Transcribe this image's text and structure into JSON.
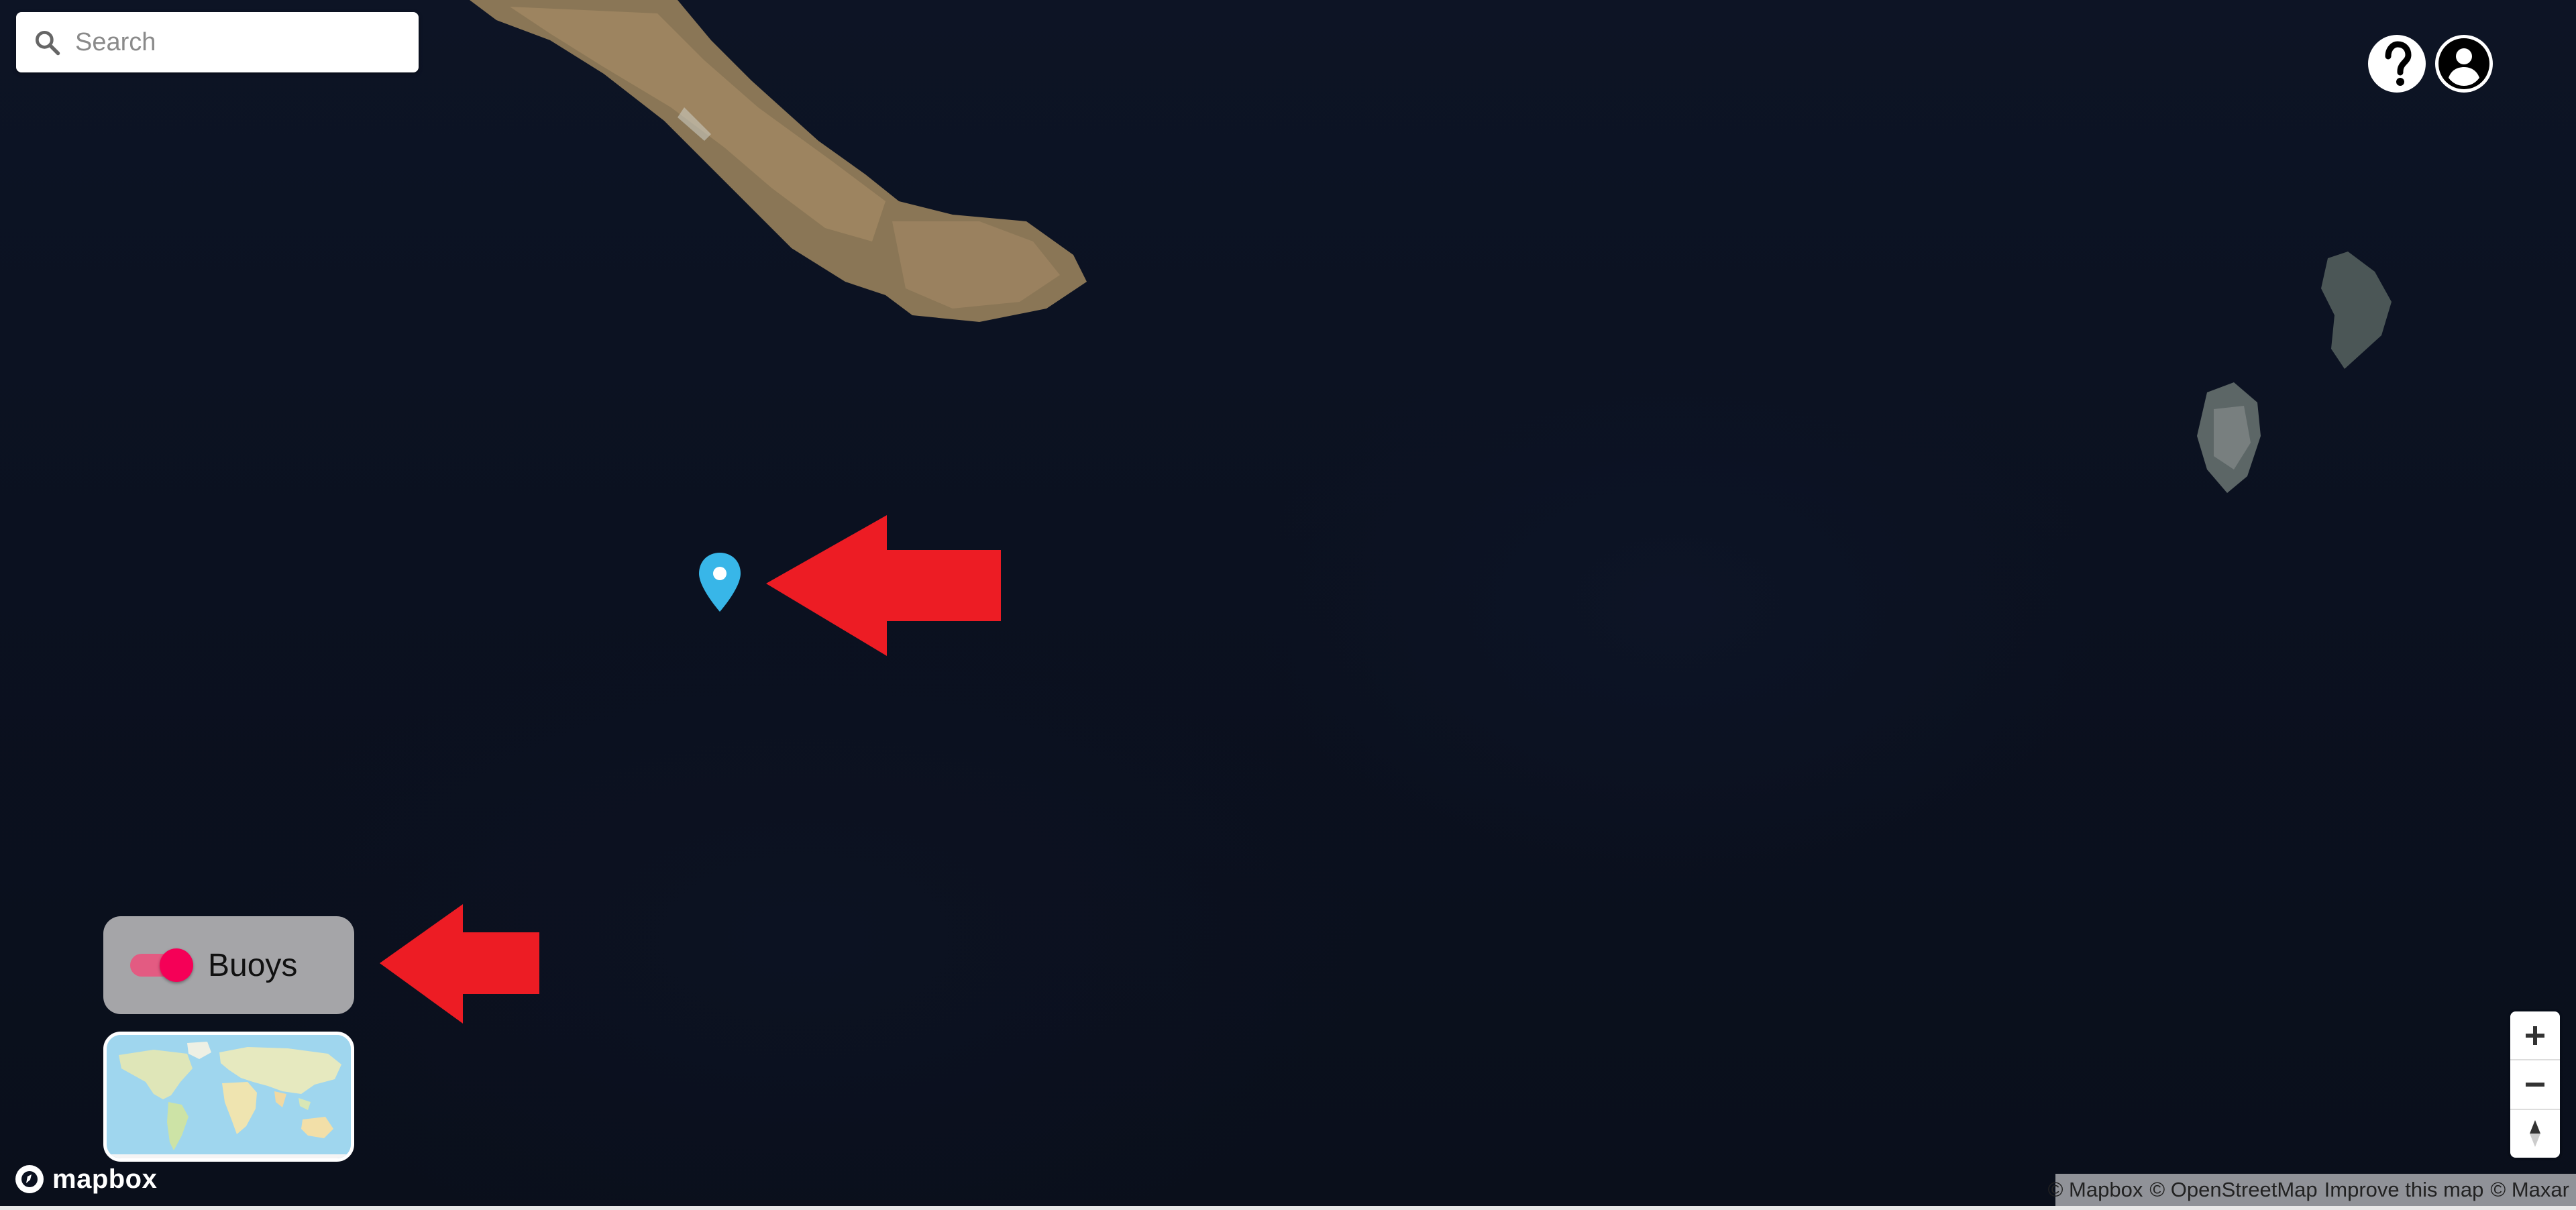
{
  "search": {
    "placeholder": "Search",
    "icon": "search-icon"
  },
  "header": {
    "help_icon": "help-icon",
    "account_icon": "account-icon"
  },
  "map": {
    "marker_icon": "buoy-marker-icon",
    "marker_color": "#38b6e8"
  },
  "layers": {
    "buoys_label": "Buoys",
    "buoys_enabled": true,
    "switch_color": "#f50057"
  },
  "annotations": {
    "arrow_color": "#ed1c24"
  },
  "branding": {
    "logo_text": "mapbox"
  },
  "zoom": {
    "in_icon": "plus-icon",
    "out_icon": "minus-icon",
    "compass_icon": "compass-icon"
  },
  "attribution": {
    "mapbox": "© Mapbox",
    "osm": "© OpenStreetMap",
    "improve": "Improve this map",
    "maxar": "© Maxar"
  }
}
